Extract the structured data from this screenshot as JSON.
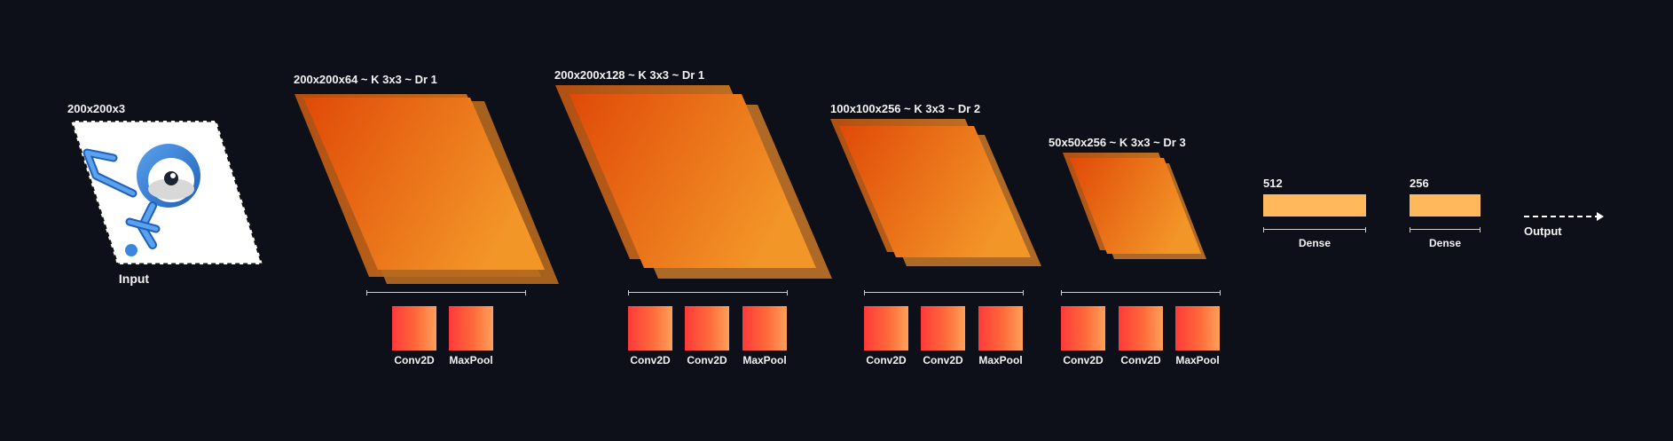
{
  "input": {
    "size_label": "200x200x3",
    "caption": "Input"
  },
  "layers": [
    {
      "label": "200x200x64 ~ K 3x3 ~ Dr 1",
      "ops": [
        "Conv2D",
        "MaxPool"
      ]
    },
    {
      "label": "200x200x128 ~ K 3x3 ~ Dr 1",
      "ops": [
        "Conv2D",
        "Conv2D",
        "MaxPool"
      ]
    },
    {
      "label": "100x100x256 ~ K 3x3 ~ Dr 2",
      "ops": [
        "Conv2D",
        "Conv2D",
        "MaxPool"
      ]
    },
    {
      "label": "50x50x256 ~ K 3x3 ~ Dr 3",
      "ops": [
        "Conv2D",
        "Conv2D",
        "MaxPool"
      ]
    }
  ],
  "dense": [
    {
      "units": "512",
      "caption": "Dense"
    },
    {
      "units": "256",
      "caption": "Dense"
    }
  ],
  "output": {
    "caption": "Output"
  },
  "colors": {
    "background": "#0d1018",
    "feature_map_dark": "#e04a08",
    "feature_map_light": "#f08a20",
    "block_left": "#ff3a3a",
    "block_right": "#ffa15a",
    "dense_fill": "#ffb85c",
    "input_icon": "#3a86e0"
  }
}
